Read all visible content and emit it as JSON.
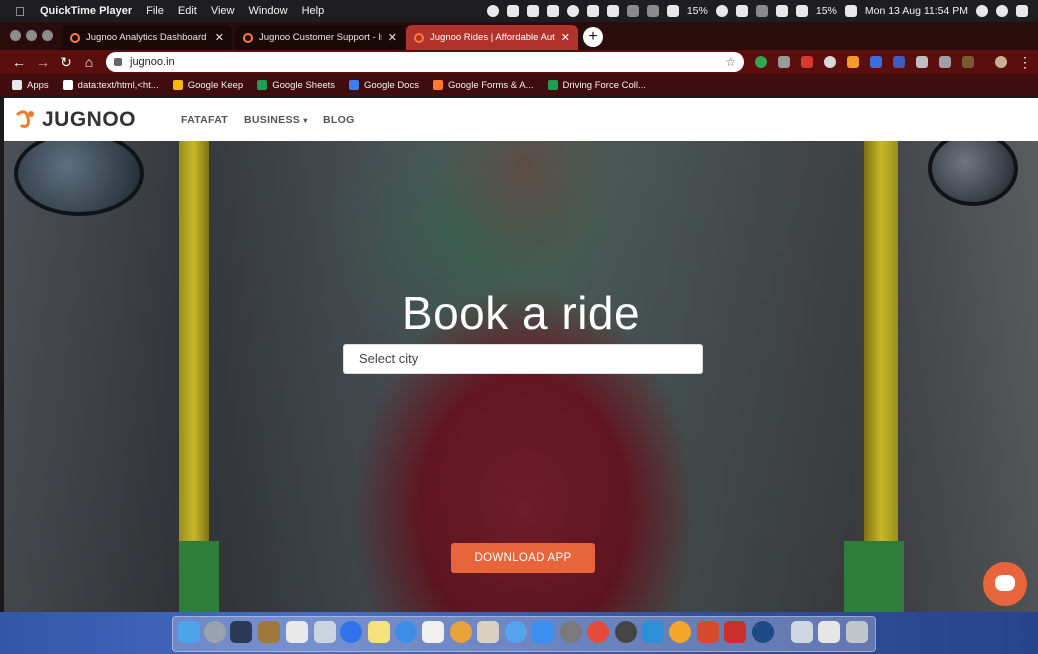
{
  "menubar": {
    "app_name": "QuickTime Player",
    "menus": [
      "File",
      "Edit",
      "View",
      "Window",
      "Help"
    ],
    "battery_1": "15%",
    "battery_2": "15%",
    "datetime": "Mon 13 Aug  11:54 PM"
  },
  "tabs": [
    {
      "title": "Jugnoo Analytics Dashboard",
      "active": false
    },
    {
      "title": "Jugnoo Customer Support - Is",
      "active": false
    },
    {
      "title": "Jugnoo Rides | Affordable Auto",
      "active": true
    }
  ],
  "toolbar": {
    "url": "jugnoo.in"
  },
  "bookmarks": [
    {
      "label": "Apps",
      "icon": "apps-grid-icon",
      "color": "#e8e8e8"
    },
    {
      "label": "data:text/html,<ht...",
      "icon": "page-icon",
      "color": "#ffffff"
    },
    {
      "label": "Google Keep",
      "icon": "keep-icon",
      "color": "#f6b900"
    },
    {
      "label": "Google Sheets",
      "icon": "sheets-icon",
      "color": "#1e9e52"
    },
    {
      "label": "Google Docs",
      "icon": "docs-icon",
      "color": "#3a7ef0"
    },
    {
      "label": "Google Forms & A...",
      "icon": "forms-icon",
      "color": "#ff7a2f"
    },
    {
      "label": "Driving Force Coll...",
      "icon": "sheets-icon",
      "color": "#1e9e52"
    }
  ],
  "site": {
    "logo_text": "JUGNOO",
    "nav": {
      "fatafat": "FATAFAT",
      "business": "BUSINESS",
      "blog": "BLOG"
    },
    "hero_title": "Book a ride",
    "city_placeholder": "Select city",
    "download_label": "DOWNLOAD APP"
  },
  "colors": {
    "accent": "#e8643a",
    "active_tab": "#b2332b"
  }
}
